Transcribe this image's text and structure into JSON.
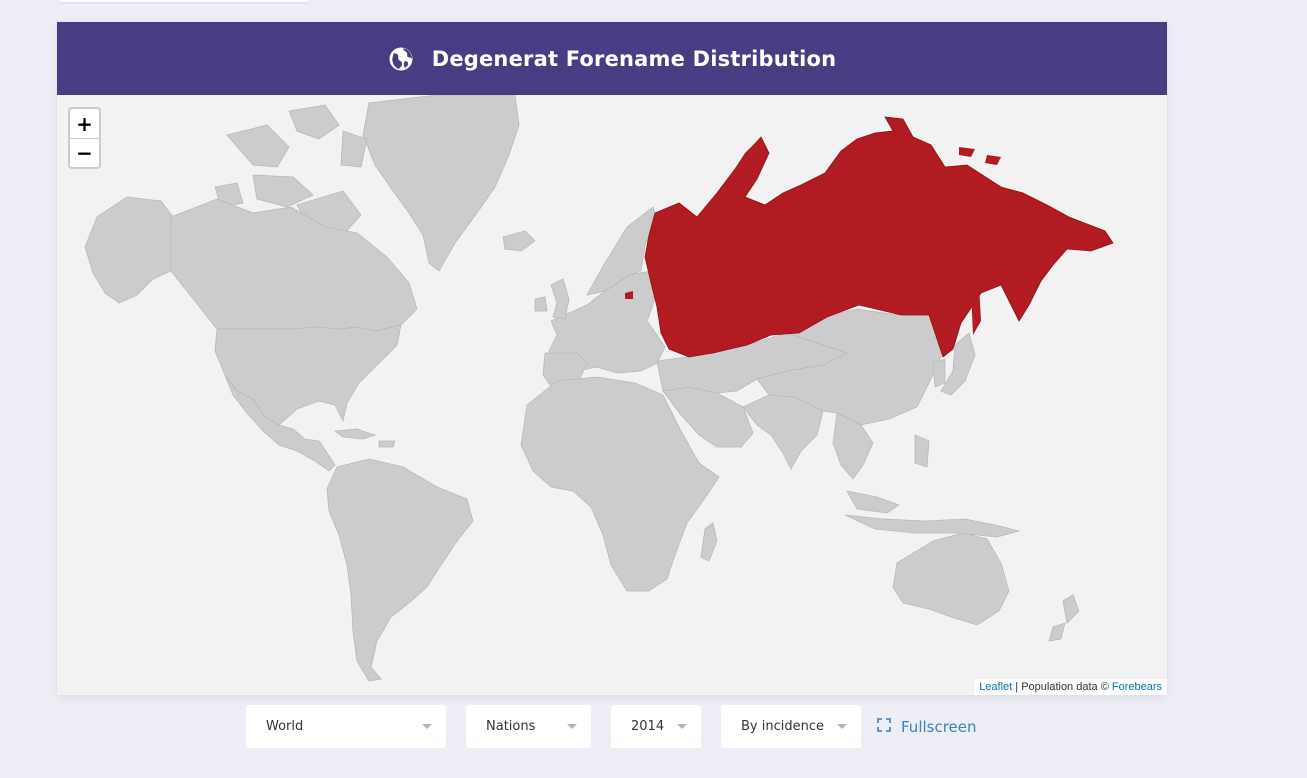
{
  "header": {
    "title": "Degenerat Forename Distribution",
    "icon": "globe-icon"
  },
  "map": {
    "zoom_in_label": "+",
    "zoom_out_label": "−",
    "attribution": {
      "leaflet": "Leaflet",
      "separator": " | Population data © ",
      "source": "Forebears"
    },
    "highlighted_country": "Russia",
    "highlight_color": "#b31b22",
    "land_color": "#cccccc",
    "water_color": "#f2f2f2"
  },
  "controls": {
    "region": "World",
    "level": "Nations",
    "year": "2014",
    "sort": "By incidence",
    "fullscreen_label": "Fullscreen"
  },
  "colors": {
    "header_bg": "#483d82",
    "page_bg": "#ededf5",
    "link": "#3e7fbf"
  }
}
